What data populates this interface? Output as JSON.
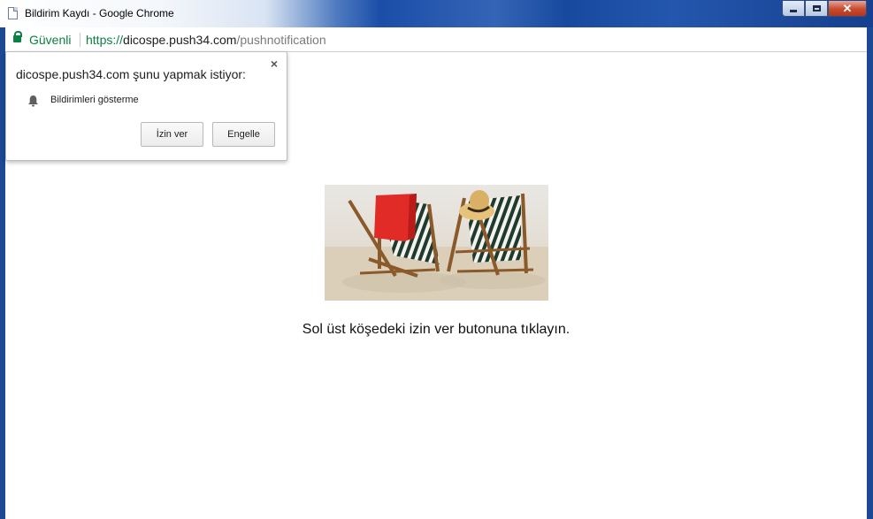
{
  "window": {
    "title": "Bildirim Kaydı - Google Chrome",
    "controls": {
      "minimize": "",
      "maximize": "",
      "close": "✕"
    }
  },
  "address_bar": {
    "security_label": "Güvenli",
    "url_scheme": "https://",
    "url_host": "dicospe.push34.com",
    "url_path": "/pushnotification",
    "security_color": "#0b8043"
  },
  "permission_prompt": {
    "title": "dicospe.push34.com şunu yapmak istiyor:",
    "close_glyph": "×",
    "permission_icon": "bell-icon",
    "permission_text": "Bildirimleri gösterme",
    "allow_button": "İzin ver",
    "block_button": "Engelle"
  },
  "page": {
    "image": "beach-chairs-image",
    "instruction": "Sol üst köşedeki izin ver butonuna tıklayın."
  }
}
